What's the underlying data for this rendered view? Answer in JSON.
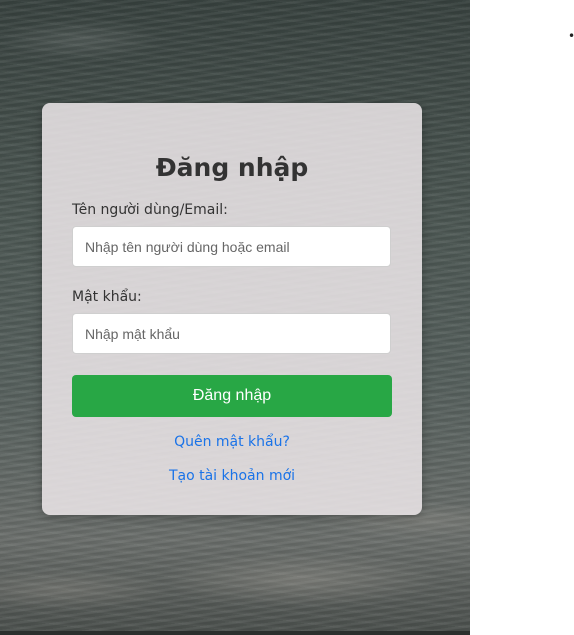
{
  "login_form": {
    "title": "Đăng nhập",
    "username_label": "Tên người dùng/Email:",
    "username_placeholder": "Nhập tên người dùng hoặc email",
    "username_value": "",
    "password_label": "Mật khẩu:",
    "password_placeholder": "Nhập mật khẩu",
    "password_value": "",
    "submit_label": "Đăng nhập",
    "forgot_password_link": "Quên mật khẩu?",
    "create_account_link": "Tạo tài khoản mới"
  },
  "side": {
    "bullet": "•"
  },
  "colors": {
    "submit_button": "#28a745",
    "link": "#1a73e8",
    "title": "#333333"
  }
}
